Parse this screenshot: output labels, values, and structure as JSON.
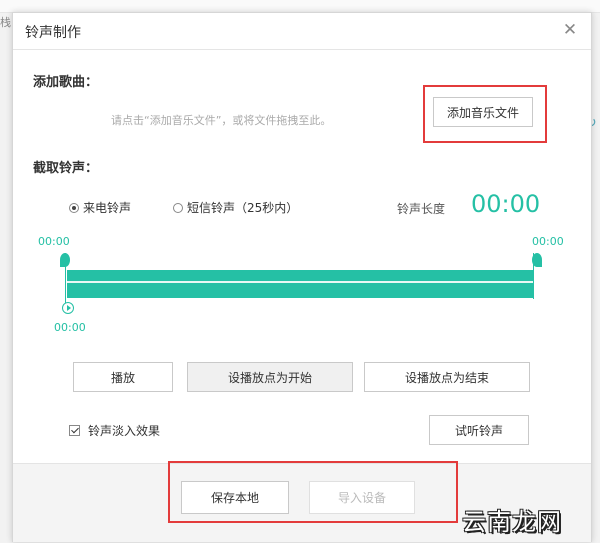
{
  "background": {
    "left_fragment": "栈"
  },
  "dialog": {
    "title": "铃声制作",
    "close_icon": "close-icon"
  },
  "add_song": {
    "label": "添加歌曲：",
    "hint": "请点击“添加音乐文件”，或将文件拖拽至此。",
    "button": "添加音乐文件"
  },
  "cut": {
    "label": "截取铃声：",
    "radio_call": "来电铃声",
    "radio_sms": "短信铃声（25秒内）",
    "selected": "来电铃声",
    "length_label": "铃声长度",
    "length_value": "00:00",
    "start_time": "00:00",
    "end_time": "00:00",
    "play_time": "00:00"
  },
  "controls": {
    "play": "播放",
    "set_start": "设播放点为开始",
    "set_end": "设播放点为结束",
    "fade_label": "铃声淡入效果",
    "fade_checked": true,
    "preview": "试听铃声"
  },
  "footer": {
    "save": "保存本地",
    "import": "导入设备"
  },
  "watermark": "云南龙网",
  "colors": {
    "accent": "#25c0a5",
    "highlight": "#e33b3b"
  }
}
